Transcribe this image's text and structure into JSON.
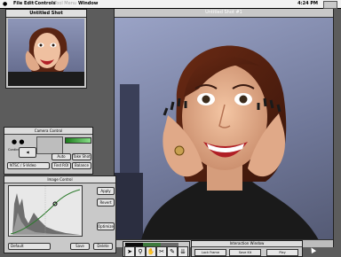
{
  "menubar": {
    "apple_glyph": "",
    "items": [
      "File",
      "Edit",
      "Controls",
      "Tool Menu",
      "Window"
    ],
    "clock": "4:24 PM"
  },
  "big_window": {
    "title": "Untitled Shot #1",
    "status_text": ""
  },
  "thumb_window": {
    "title": "Untitled Shot"
  },
  "camera_control": {
    "title": "Camera Control",
    "buttons": [
      "Auto",
      "Take Shot",
      "Find ROI",
      "Balance"
    ],
    "dropdown_value": "NTSC / S-Video",
    "small_labels": [
      "Continuous",
      "Size"
    ]
  },
  "image_control": {
    "title": "Image Control",
    "buttons": [
      "Apply",
      "Revert",
      "Optimize",
      "Save",
      "Delete"
    ],
    "dropdown_value": "Default"
  },
  "interaction_window": {
    "title": "Interaction Window",
    "buttons": [
      "Lock Frame",
      "Save Kit",
      "Play"
    ]
  },
  "toolbar": {
    "icons": [
      "arrow-icon",
      "magnify-icon",
      "hand-icon",
      "crop-icon",
      "pen-icon",
      "eyedropper-icon"
    ],
    "swatch_colors": [
      "#0a0a0a",
      "#3d7a3d",
      "#6a6a6a"
    ]
  },
  "colors": {
    "desktop": "#5c5c5c",
    "window": "#c9c9c9",
    "menubar": "#f2f2f2"
  }
}
